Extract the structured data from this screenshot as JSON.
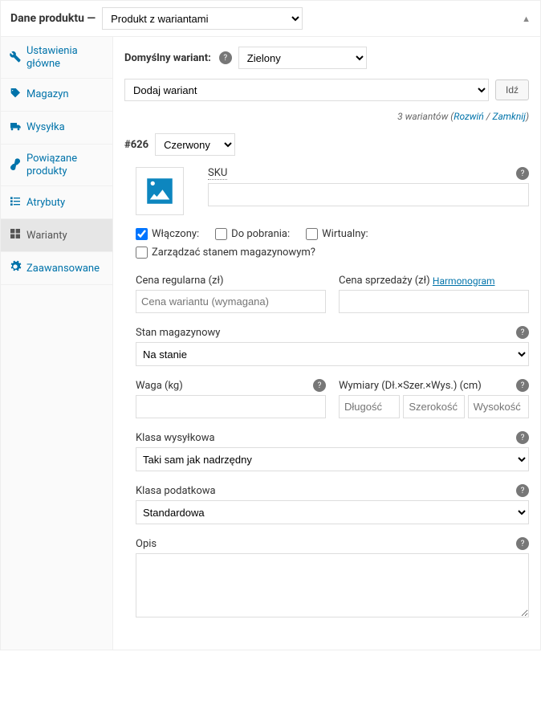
{
  "header": {
    "title": "Dane produktu —",
    "product_type": "Produkt z wariantami"
  },
  "sidebar": {
    "items": [
      {
        "label": "Ustawienia główne"
      },
      {
        "label": "Magazyn"
      },
      {
        "label": "Wysyłka"
      },
      {
        "label": "Powiązane produkty"
      },
      {
        "label": "Atrybuty"
      },
      {
        "label": "Warianty"
      },
      {
        "label": "Zaawansowane"
      }
    ]
  },
  "main": {
    "default_variant_label": "Domyślny wariant:",
    "default_variant_value": "Zielony",
    "add_variant_label": "Dodaj wariant",
    "go_button": "Idź",
    "variants_count_text": "3 wariantów",
    "expand": "Rozwiń",
    "close": "Zamknij",
    "variant": {
      "id": "#626",
      "attribute": "Czerwony",
      "sku_label": "SKU",
      "sku_value": "",
      "checkboxes": {
        "enabled": "Włączony:",
        "downloadable": "Do pobrania:",
        "virtual": "Wirtualny:",
        "manage_stock": "Zarządzać stanem magazynowym?"
      },
      "regular_price_label": "Cena regularna (zł)",
      "regular_price_placeholder": "Cena wariantu (wymagana)",
      "sale_price_label": "Cena sprzedaży (zł)",
      "schedule_link": "Harmonogram",
      "stock_label": "Stan magazynowy",
      "stock_value": "Na stanie",
      "weight_label": "Waga (kg)",
      "dimensions_label": "Wymiary (Dł.×Szer.×Wys.) (cm)",
      "dim_length": "Długość",
      "dim_width": "Szerokość",
      "dim_height": "Wysokość",
      "shipping_class_label": "Klasa wysyłkowa",
      "shipping_class_value": "Taki sam jak nadrzędny",
      "tax_class_label": "Klasa podatkowa",
      "tax_class_value": "Standardowa",
      "description_label": "Opis"
    }
  }
}
